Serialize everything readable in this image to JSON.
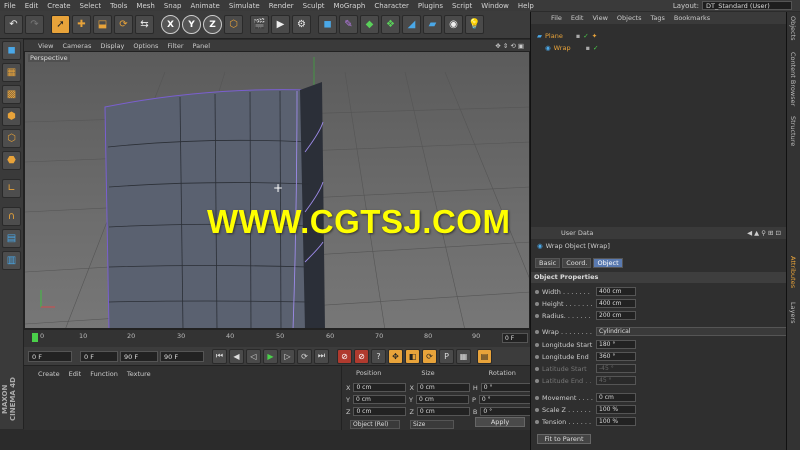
{
  "menubar": {
    "items": [
      "File",
      "Edit",
      "Create",
      "Select",
      "Tools",
      "Mesh",
      "Snap",
      "Animate",
      "Simulate",
      "Render",
      "Sculpt",
      "MoGraph",
      "Character",
      "Plugins",
      "Script",
      "Window",
      "Help"
    ],
    "layout_label": "Layout:",
    "layout_value": "DT_Standard (User)"
  },
  "toolbar": {
    "icons": [
      "undo-icon",
      "redo-icon",
      "select-cursor-icon",
      "move-icon",
      "scale-icon",
      "rotate-icon",
      "recent-tools-icon",
      "x-axis-icon",
      "y-axis-icon",
      "z-axis-icon",
      "coordinate-system-icon",
      "render-view-icon",
      "render-picture-viewer-icon",
      "render-settings-icon",
      "cube-icon",
      "pen-spline-icon",
      "subdivision-surface-icon",
      "array-icon",
      "bend-deformer-icon",
      "floor-icon",
      "camera-icon",
      "light-icon"
    ],
    "xyz": [
      "X",
      "Y",
      "Z"
    ]
  },
  "left_tools": [
    "model-mode-icon",
    "texture-mode-icon",
    "workplane-mode-icon",
    "points-mode-icon",
    "edges-mode-icon",
    "polygons-mode-icon",
    "axis-icon",
    "enable-snap-icon",
    "locked-workplane-icon",
    "planar-workplane-icon"
  ],
  "viewport": {
    "menu": [
      "View",
      "Cameras",
      "Display",
      "Options",
      "Filter",
      "Panel"
    ],
    "label": "Perspective",
    "watermark": "WWW.CGTSJ.COM"
  },
  "timeline": {
    "ticks": [
      "0",
      "10",
      "20",
      "30",
      "40",
      "50",
      "60",
      "70",
      "80",
      "90"
    ],
    "frame_end": "0 F",
    "current_frame": 0,
    "max_frame": 90
  },
  "transport": {
    "start": "0 F",
    "range_start": "0 F",
    "range_end": "90 F",
    "end": "90 F"
  },
  "material_manager": {
    "menu": [
      "Create",
      "Edit",
      "Function",
      "Texture"
    ]
  },
  "coordinates": {
    "headers": [
      "Position",
      "Size",
      "Rotation"
    ],
    "rows": [
      {
        "axis": "X",
        "pos": "0 cm",
        "size_axis": "X",
        "size": "0 cm",
        "rot_axis": "H",
        "rot": "0 °"
      },
      {
        "axis": "Y",
        "pos": "0 cm",
        "size_axis": "Y",
        "size": "0 cm",
        "rot_axis": "P",
        "rot": "0 °"
      },
      {
        "axis": "Z",
        "pos": "0 cm",
        "size_axis": "Z",
        "size": "0 cm",
        "rot_axis": "B",
        "rot": "0 °"
      }
    ],
    "mode": "Object (Rel)",
    "size_mode": "Size",
    "apply": "Apply"
  },
  "brand": "MAXON CINEMA 4D",
  "object_manager": {
    "menu": [
      "File",
      "Edit",
      "View",
      "Objects",
      "Tags",
      "Bookmarks"
    ],
    "objects": [
      "Plane",
      "Wrap"
    ]
  },
  "side_tabs": [
    "Objects",
    "Content Browser",
    "Structure",
    "Attributes",
    "Layers"
  ],
  "attributes": {
    "header": "User Data",
    "object_title": "Wrap Object [Wrap]",
    "tabs": [
      "Basic",
      "Coord.",
      "Object"
    ],
    "active_tab": "Object",
    "section": "Object Properties",
    "props": [
      {
        "label": "Width . . . . . . .",
        "value": "400 cm",
        "disabled": false
      },
      {
        "label": "Height . . . . . . .",
        "value": "400 cm",
        "disabled": false
      },
      {
        "label": "Radius. . . . . . .",
        "value": "200 cm",
        "disabled": false
      }
    ],
    "wrap_label": "Wrap . . . . . . . .",
    "wrap_value": "Cylindrical",
    "props2": [
      {
        "label": "Longitude Start",
        "value": "180 °",
        "disabled": false
      },
      {
        "label": "Longitude End",
        "value": "360 °",
        "disabled": false
      },
      {
        "label": "Latitude Start",
        "value": "-45 °",
        "disabled": true
      },
      {
        "label": "Latitude End . .",
        "value": "45 °",
        "disabled": true
      }
    ],
    "props3": [
      {
        "label": "Movement . . . .",
        "value": "0 cm",
        "disabled": false
      },
      {
        "label": "Scale Z . . . . . .",
        "value": "100 %",
        "disabled": false
      },
      {
        "label": "Tension . . . . . .",
        "value": "100 %",
        "disabled": false
      }
    ],
    "fit_button": "Fit to Parent"
  },
  "colors": {
    "accent": "#e8a33a",
    "watermark": "#ffff00",
    "active_tab": "#5a7ab0"
  }
}
